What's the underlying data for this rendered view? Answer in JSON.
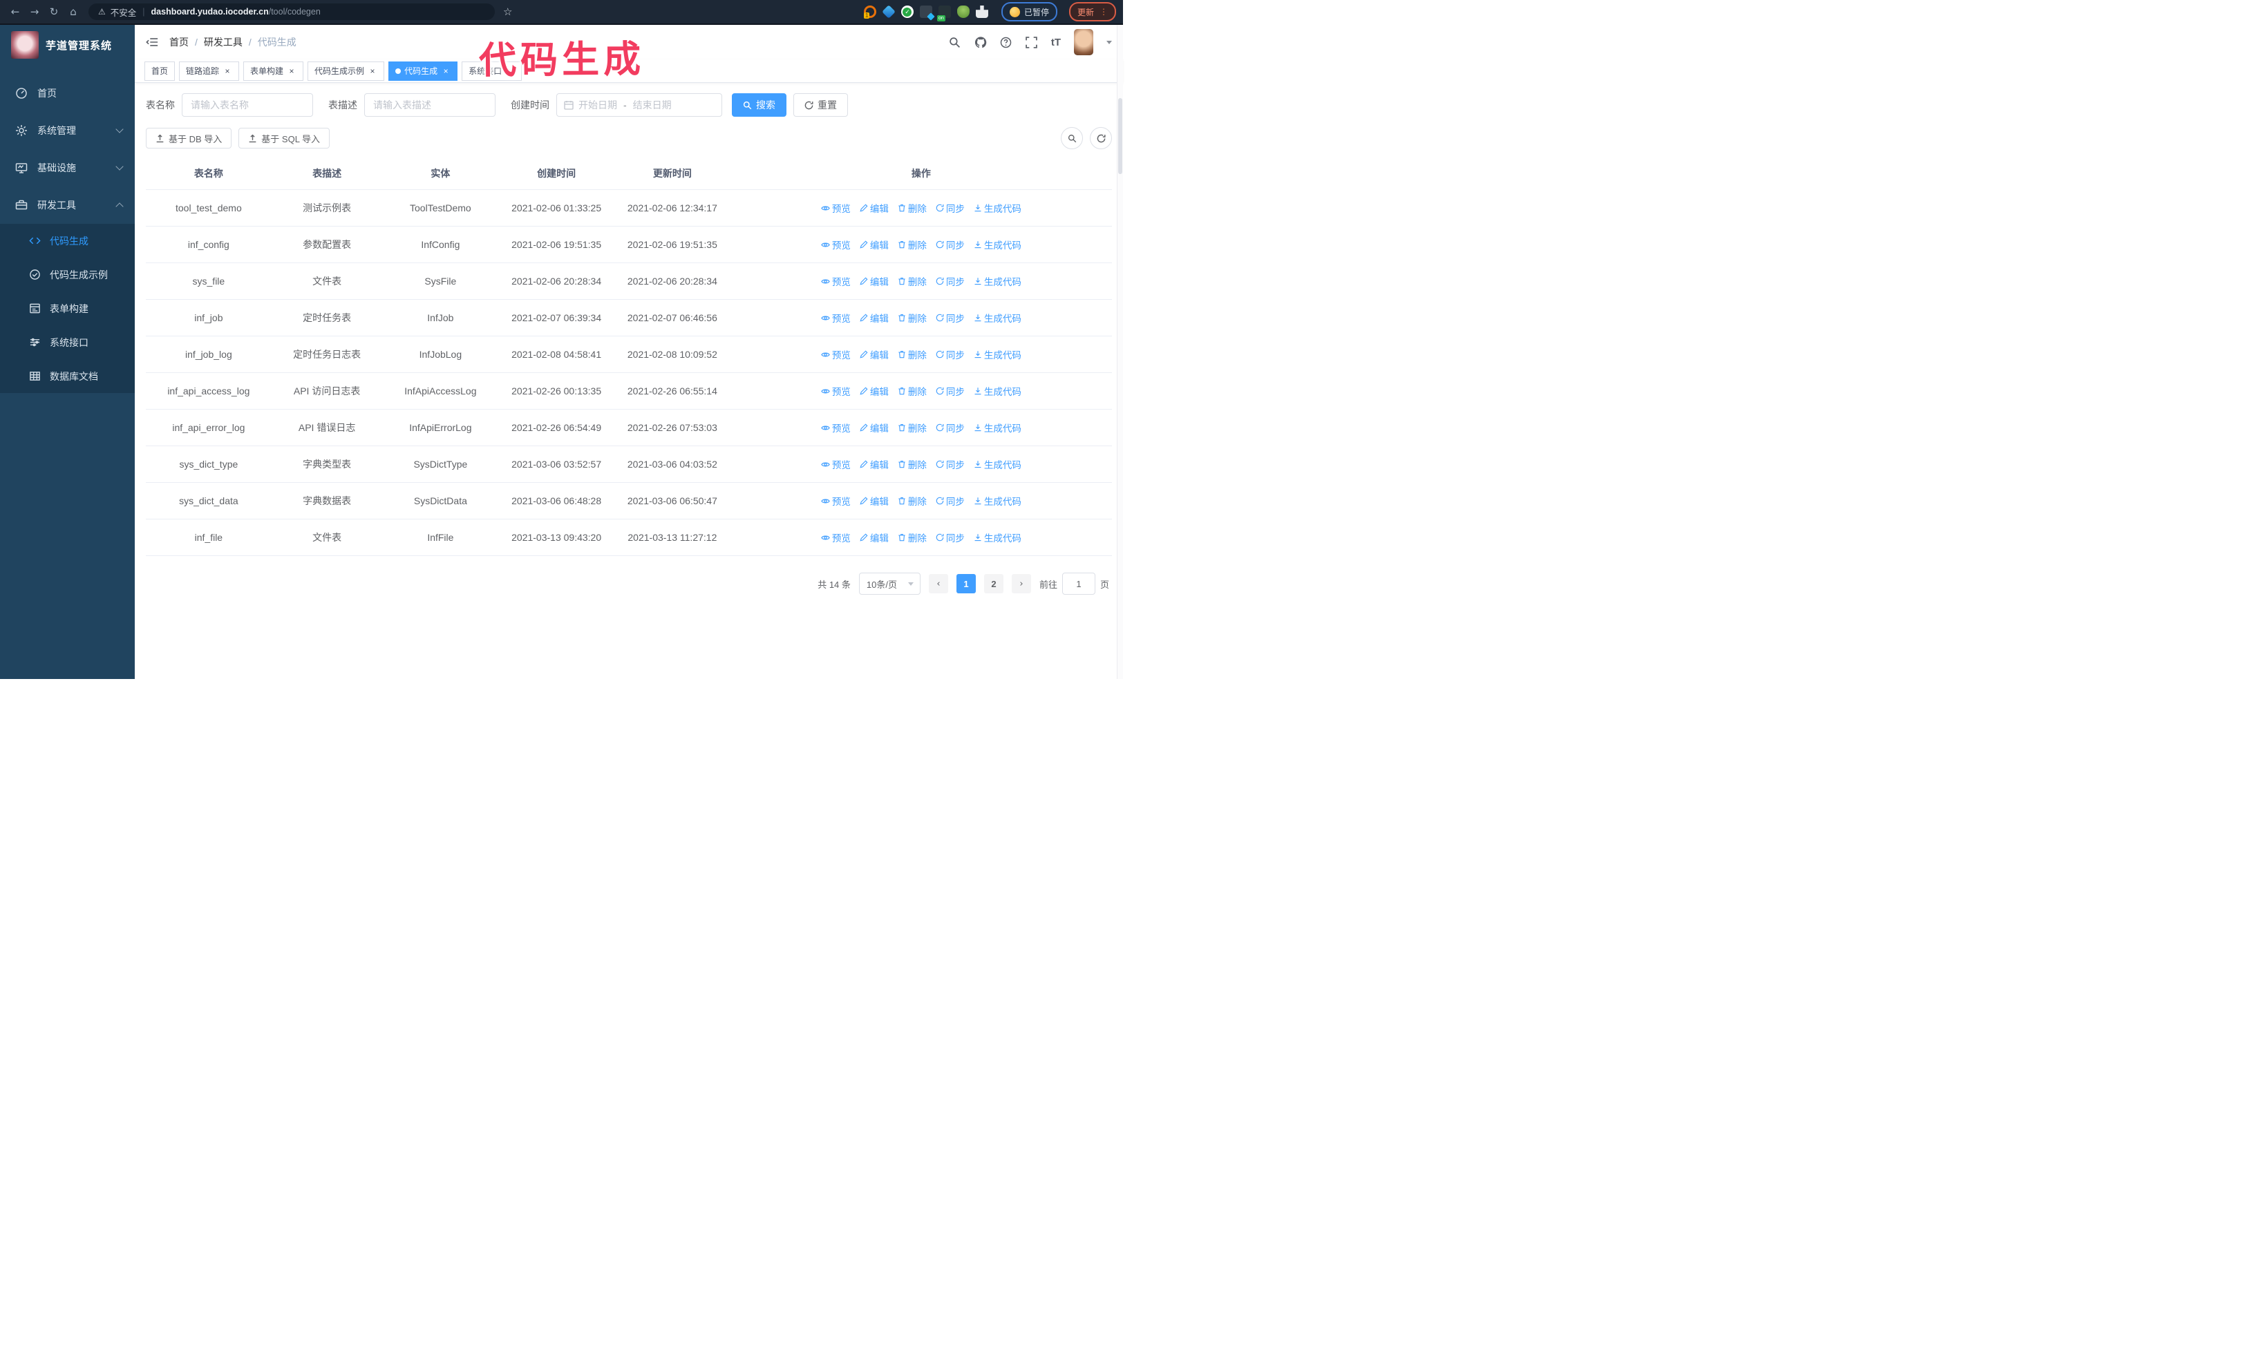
{
  "browser": {
    "security_warning": "不安全",
    "url_host": "dashboard.yudao.iocoder.cn",
    "url_path": "/tool/codegen",
    "paused_chip": "已暂停",
    "update_button": "更新"
  },
  "annotation": {
    "text": "代码生成",
    "color": "#f23c5f"
  },
  "sidebar": {
    "logo_title": "芋道管理系统",
    "items": [
      {
        "label": "首页"
      },
      {
        "label": "系统管理"
      },
      {
        "label": "基础设施"
      },
      {
        "label": "研发工具"
      }
    ],
    "submenu": [
      {
        "label": "代码生成"
      },
      {
        "label": "代码生成示例"
      },
      {
        "label": "表单构建"
      },
      {
        "label": "系统接口"
      },
      {
        "label": "数据库文档"
      }
    ]
  },
  "navbar": {
    "breadcrumb": [
      "首页",
      "研发工具",
      "代码生成"
    ],
    "font_size_tool": "tT"
  },
  "tabs": [
    {
      "label": "首页"
    },
    {
      "label": "链路追踪"
    },
    {
      "label": "表单构建"
    },
    {
      "label": "代码生成示例"
    },
    {
      "label": "代码生成"
    },
    {
      "label": "系统接口"
    }
  ],
  "search_form": {
    "table_name_label": "表名称",
    "table_name_placeholder": "请输入表名称",
    "table_desc_label": "表描述",
    "table_desc_placeholder": "请输入表描述",
    "create_time_label": "创建时间",
    "start_date_placeholder": "开始日期",
    "range_separator": "-",
    "end_date_placeholder": "结束日期",
    "search_button": "搜索",
    "reset_button": "重置"
  },
  "toolbar": {
    "import_db_button": "基于 DB 导入",
    "import_sql_button": "基于 SQL 导入"
  },
  "table": {
    "columns": [
      "表名称",
      "表描述",
      "实体",
      "创建时间",
      "更新时间",
      "操作"
    ],
    "actions": [
      "预览",
      "编辑",
      "删除",
      "同步",
      "生成代码"
    ],
    "rows": [
      {
        "name": "tool_test_demo",
        "desc": "测试示例表",
        "entity": "ToolTestDemo",
        "create_time": "2021-02-06 01:33:25",
        "update_time": "2021-02-06 12:34:17"
      },
      {
        "name": "inf_config",
        "desc": "参数配置表",
        "entity": "InfConfig",
        "create_time": "2021-02-06 19:51:35",
        "update_time": "2021-02-06 19:51:35"
      },
      {
        "name": "sys_file",
        "desc": "文件表",
        "entity": "SysFile",
        "create_time": "2021-02-06 20:28:34",
        "update_time": "2021-02-06 20:28:34"
      },
      {
        "name": "inf_job",
        "desc": "定时任务表",
        "entity": "InfJob",
        "create_time": "2021-02-07 06:39:34",
        "update_time": "2021-02-07 06:46:56"
      },
      {
        "name": "inf_job_log",
        "desc": "定时任务日志表",
        "entity": "InfJobLog",
        "create_time": "2021-02-08 04:58:41",
        "update_time": "2021-02-08 10:09:52"
      },
      {
        "name": "inf_api_access_log",
        "desc": "API 访问日志表",
        "entity": "InfApiAccessLog",
        "create_time": "2021-02-26 00:13:35",
        "update_time": "2021-02-26 06:55:14"
      },
      {
        "name": "inf_api_error_log",
        "desc": "API 错误日志",
        "entity": "InfApiErrorLog",
        "create_time": "2021-02-26 06:54:49",
        "update_time": "2021-02-26 07:53:03"
      },
      {
        "name": "sys_dict_type",
        "desc": "字典类型表",
        "entity": "SysDictType",
        "create_time": "2021-03-06 03:52:57",
        "update_time": "2021-03-06 04:03:52"
      },
      {
        "name": "sys_dict_data",
        "desc": "字典数据表",
        "entity": "SysDictData",
        "create_time": "2021-03-06 06:48:28",
        "update_time": "2021-03-06 06:50:47"
      },
      {
        "name": "inf_file",
        "desc": "文件表",
        "entity": "InfFile",
        "create_time": "2021-03-13 09:43:20",
        "update_time": "2021-03-13 11:27:12"
      }
    ]
  },
  "pagination": {
    "total_text": "共 14 条",
    "page_size": "10条/页",
    "pages": [
      "1",
      "2"
    ],
    "current_page": "1",
    "goto_label": "前往",
    "goto_value": "1",
    "goto_suffix": "页"
  },
  "colors": {
    "accent": "#409eff",
    "sidebar_bg": "#20445f",
    "submenu_bg": "#193850",
    "annotation": "#f23c5f"
  }
}
